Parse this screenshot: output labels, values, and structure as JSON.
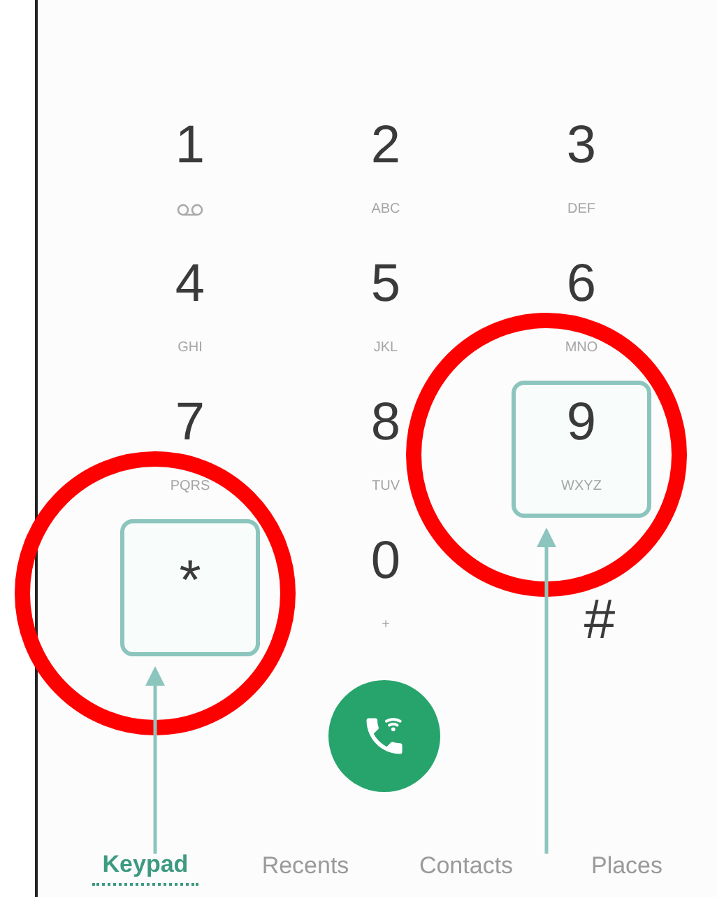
{
  "keypad": {
    "keys": [
      {
        "kind": "voicemail",
        "digit": "1",
        "highlighted": false
      },
      {
        "kind": "digit",
        "digit": "2",
        "letters": "ABC",
        "highlighted": false
      },
      {
        "kind": "digit",
        "digit": "3",
        "letters": "DEF",
        "highlighted": false
      },
      {
        "kind": "digit",
        "digit": "4",
        "letters": "GHI",
        "highlighted": false
      },
      {
        "kind": "digit",
        "digit": "5",
        "letters": "JKL",
        "highlighted": false
      },
      {
        "kind": "digit",
        "digit": "6",
        "letters": "MNO",
        "highlighted": false
      },
      {
        "kind": "digit",
        "digit": "7",
        "letters": "PQRS",
        "highlighted": false
      },
      {
        "kind": "digit",
        "digit": "8",
        "letters": "TUV",
        "highlighted": false
      },
      {
        "kind": "digit",
        "digit": "9",
        "letters": "WXYZ",
        "highlighted": true
      },
      {
        "kind": "symbol",
        "digit": "*",
        "highlighted": true
      },
      {
        "kind": "digit",
        "digit": "0",
        "letters": "+",
        "highlighted": false
      },
      {
        "kind": "symbol",
        "digit": "#",
        "highlighted": false
      }
    ]
  },
  "call_button": {
    "kind": "voice"
  },
  "tabs": [
    {
      "label": "Keypad",
      "selected": true,
      "pointer": true
    },
    {
      "label": "Recents",
      "selected": false,
      "pointer": false
    },
    {
      "label": "Contacts",
      "selected": false,
      "pointer": false
    },
    {
      "label": "Places",
      "selected": false,
      "pointer": true
    }
  ]
}
